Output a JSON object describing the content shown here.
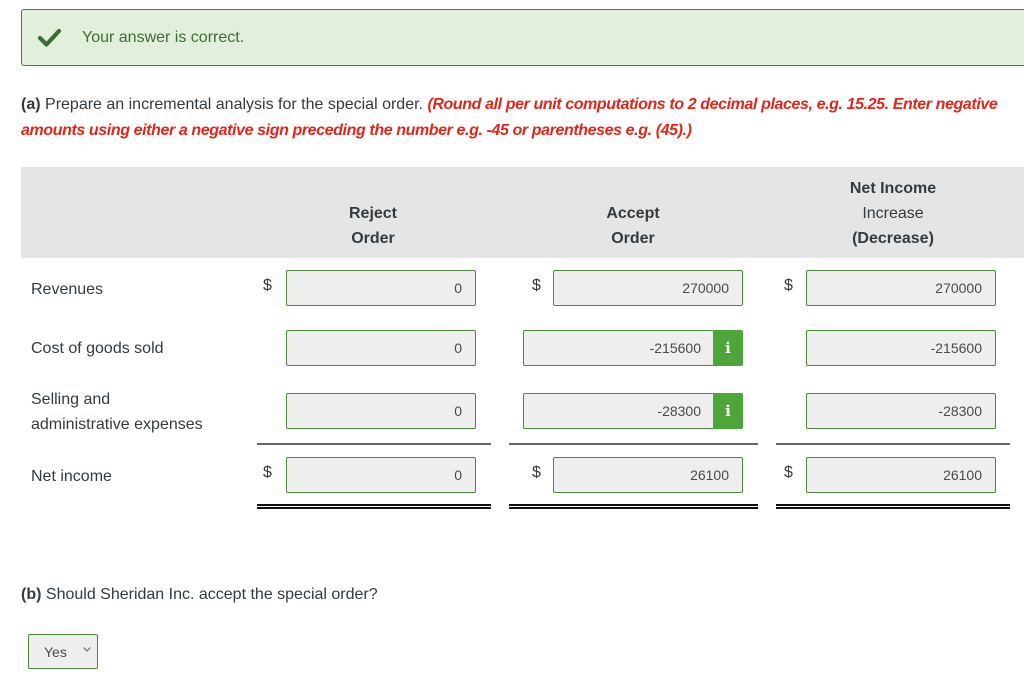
{
  "feedback": {
    "icon": "checkmark-icon",
    "message": "Your answer is correct."
  },
  "part_a": {
    "label": "(a)",
    "question": "Prepare an incremental analysis for the special order.",
    "instruction": "(Round all per unit computations to 2 decimal places, e.g. 15.25. Enter negative amounts using either a negative sign preceding the number e.g. -45 or parentheses e.g. (45).)"
  },
  "table": {
    "columns": [
      {
        "line1": "",
        "line2": "Reject",
        "line3": "Order"
      },
      {
        "line1": "",
        "line2": "Accept",
        "line3": "Order"
      },
      {
        "line1": "Net Income",
        "line2": "Increase",
        "line3": "(Decrease)"
      }
    ],
    "currency_symbol": "$",
    "rows": [
      {
        "label_line1": "Revenues",
        "label_line2": "",
        "values": [
          "0",
          "270000",
          "270000"
        ],
        "show_dollar": true,
        "info": false
      },
      {
        "label_line1": "Cost of goods sold",
        "label_line2": "",
        "values": [
          "0",
          "-215600",
          "-215600"
        ],
        "show_dollar": false,
        "info": true
      },
      {
        "label_line1": "Selling and",
        "label_line2": "administrative expenses",
        "values": [
          "0",
          "-28300",
          "-28300"
        ],
        "show_dollar": false,
        "info": true
      },
      {
        "label_line1": "Net income",
        "label_line2": "",
        "values": [
          "0",
          "26100",
          "26100"
        ],
        "show_dollar": true,
        "info": false
      }
    ],
    "info_glyph": "i"
  },
  "part_b": {
    "label": "(b)",
    "question": "Should Sheridan Inc. accept the special order?",
    "selected": "Yes"
  },
  "colors": {
    "success_bg": "#e2efda",
    "success_border": "#4d7a40",
    "instruction_red": "#e3261b",
    "info_green": "#4ea539",
    "header_bg": "#e5e5e5"
  }
}
